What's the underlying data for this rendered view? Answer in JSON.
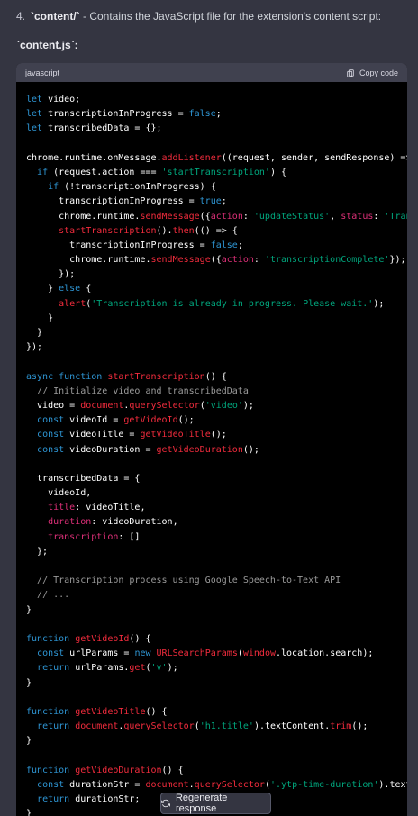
{
  "intro": {
    "number": "4.",
    "code": "`content/`",
    "text": " - Contains the JavaScript file for the extension's content script:"
  },
  "filename": "`content.js`:",
  "code_block": {
    "language": "javascript",
    "copy_label": "Copy code"
  },
  "regenerate_label": "Regenerate response",
  "icons": {
    "copy": "clipboard-icon",
    "regenerate": "refresh-icon"
  },
  "colors": {
    "background": "#343541",
    "code_background": "#000000",
    "keyword": "#2e95d3",
    "string": "#00a67d",
    "function": "#f22c3d",
    "comment": "#9a9a9a"
  }
}
